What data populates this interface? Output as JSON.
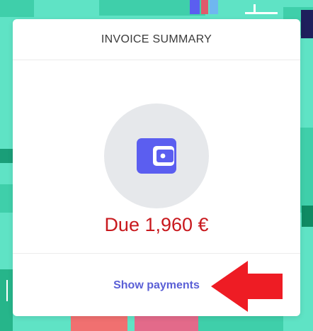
{
  "card": {
    "title": "INVOICE SUMMARY",
    "icon": "wallet-icon",
    "due_text": "Due 1,960 €",
    "link_text": "Show payments"
  },
  "annotation": {
    "icon": "red-arrow-pointing-left"
  },
  "colors": {
    "background": "#5fe3c5",
    "card": "#ffffff",
    "wallet_circle": "#e6e8eb",
    "wallet_icon": "#5b5ef0",
    "due_text": "#c8191e",
    "link": "#5a5fd6",
    "arrow": "#ee1c24"
  }
}
